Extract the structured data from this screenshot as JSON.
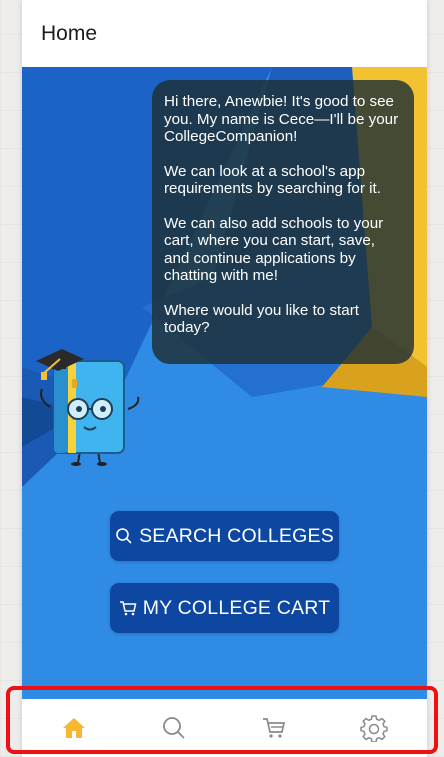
{
  "header": {
    "title": "Home"
  },
  "chat": {
    "paragraphs": [
      "Hi there, Anewbie! It's good to see you. My name is Cece—I'll be your CollegeCompanion!",
      "We can look at a school's app requirements by searching for it.",
      "We can also add schools to your cart, where you can start, save, and continue applications by chatting with me!",
      "Where would you like to start today?"
    ]
  },
  "buttons": {
    "search_label": "SEARCH COLLEGES",
    "cart_label": "MY COLLEGE CART"
  },
  "tabbar": {
    "tabs": [
      {
        "icon": "home-icon",
        "active": true
      },
      {
        "icon": "search-icon",
        "active": false
      },
      {
        "icon": "cart-icon",
        "active": false
      },
      {
        "icon": "gear-icon",
        "active": false
      }
    ]
  },
  "colors": {
    "hero_blue": "#2f8be3",
    "button_blue": "#0d47a1",
    "active_tab": "#f7b733",
    "inactive_tab": "#8a8a8a",
    "highlight": "#ee1111"
  }
}
